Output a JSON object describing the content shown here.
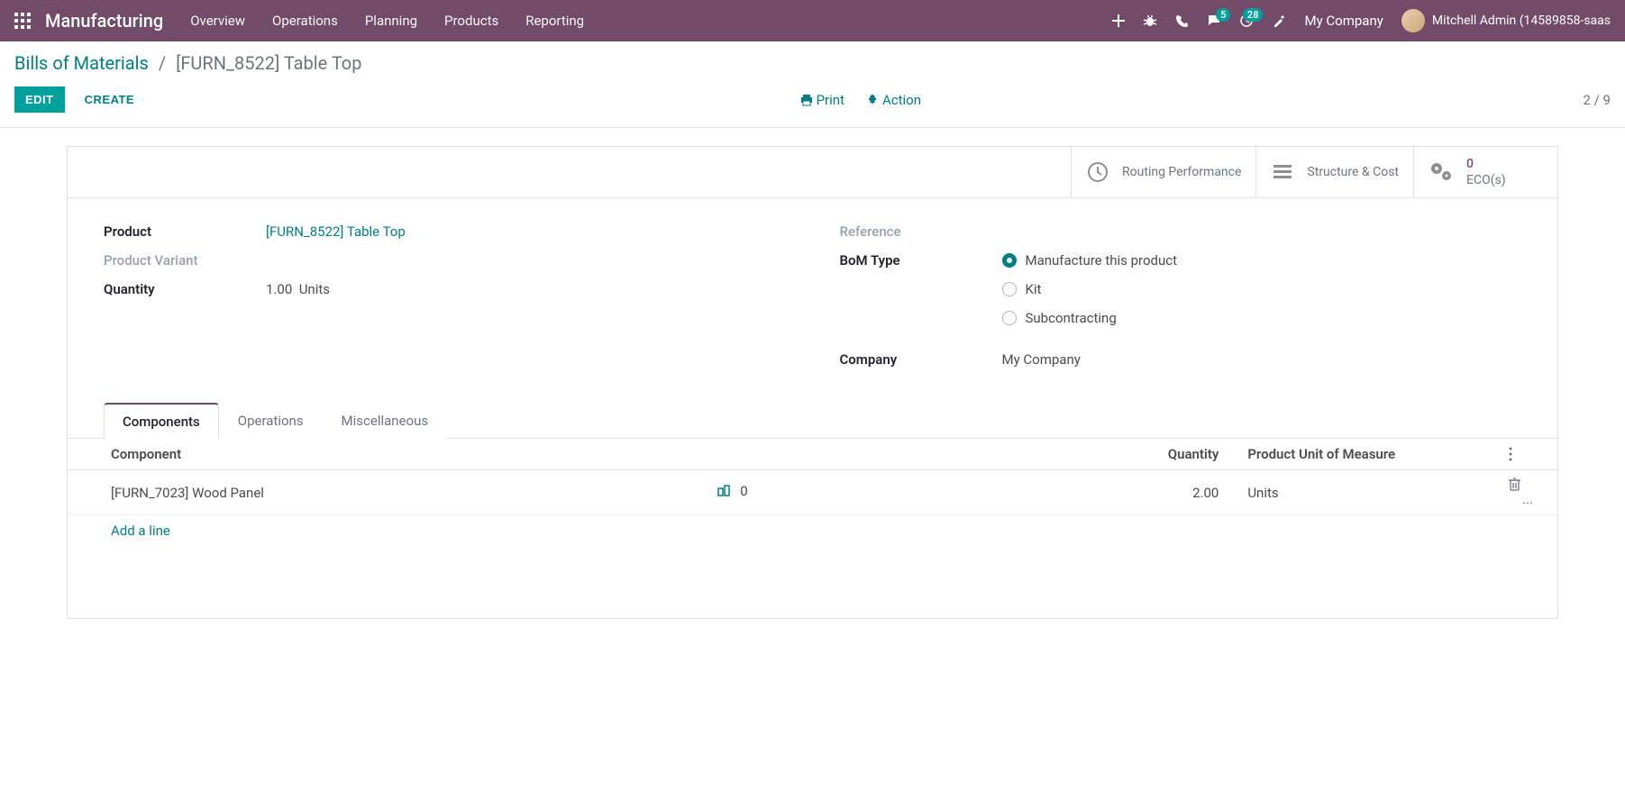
{
  "navbar": {
    "brand": "Manufacturing",
    "links": [
      "Overview",
      "Operations",
      "Planning",
      "Products",
      "Reporting"
    ],
    "messaging_badge": "5",
    "activities_badge": "28",
    "company": "My Company",
    "user": "Mitchell Admin (14589858-saas"
  },
  "breadcrumb": {
    "root": "Bills of Materials",
    "current": "[FURN_8522] Table Top"
  },
  "buttons": {
    "edit": "EDIT",
    "create": "CREATE",
    "print": "Print",
    "action": "Action"
  },
  "pager": "2 / 9",
  "stat_buttons": {
    "routing": "Routing Performance",
    "structure": "Structure & Cost",
    "eco_count": "0",
    "eco_label": "ECO(s)"
  },
  "form": {
    "product_label": "Product",
    "product_value": "[FURN_8522] Table Top",
    "variant_label": "Product Variant",
    "qty_label": "Quantity",
    "qty_value": "1.00",
    "qty_unit": "Units",
    "reference_label": "Reference",
    "bomtype_label": "BoM Type",
    "bomtype_options": {
      "manufacture": "Manufacture this product",
      "kit": "Kit",
      "subcontracting": "Subcontracting"
    },
    "company_label": "Company",
    "company_value": "My Company"
  },
  "tabs": {
    "components": "Components",
    "operations": "Operations",
    "misc": "Miscellaneous"
  },
  "table": {
    "col_component": "Component",
    "col_qty": "Quantity",
    "col_uom": "Product Unit of Measure",
    "rows": [
      {
        "name": "[FURN_7023] Wood Panel",
        "mid": "0",
        "qty": "2.00",
        "uom": "Units"
      }
    ],
    "add_line": "Add a line"
  }
}
